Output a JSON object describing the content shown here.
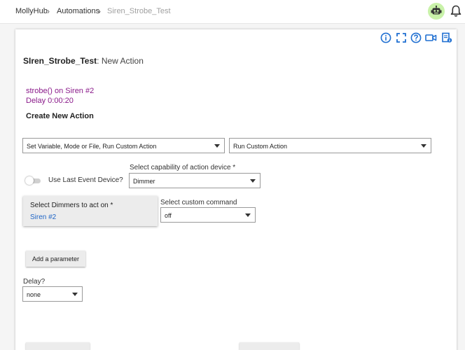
{
  "breadcrumb": {
    "home": "MollyHub",
    "section": "Automations",
    "current": "Siren_Strobe_Test"
  },
  "header": {
    "robot_icon": "robot-icon",
    "bell_icon": "bell-icon",
    "accent_color": "#c9f2a9"
  },
  "toolbar": {
    "icons": [
      "info-icon",
      "fullscreen-icon",
      "help-icon",
      "video-icon",
      "document-icon"
    ],
    "icon_color": "#1f6fd1"
  },
  "page": {
    "title_name": "SIren_Strobe_Test",
    "title_sep": ":",
    "title_sub": " New Action"
  },
  "summary": {
    "line1": "strobe() on Siren #2",
    "line2": "Delay 0:00:20",
    "color": "#8a1a8a"
  },
  "form": {
    "heading": "Create New Action",
    "action_type_select": "Set Variable, Mode or File, Run Custom Action",
    "action_select": "Run Custom Action",
    "use_last_event_label": "Use Last Event Device?",
    "capability_label": "Select capability of action device *",
    "capability_value": "Dimmer",
    "devices_label": "Select Dimmers to act on *",
    "devices_value": "Siren #2",
    "command_label": "Select custom command",
    "command_value": "off",
    "add_parameter_button": "Add a parameter",
    "delay_label": "Delay?",
    "delay_value": "none"
  }
}
